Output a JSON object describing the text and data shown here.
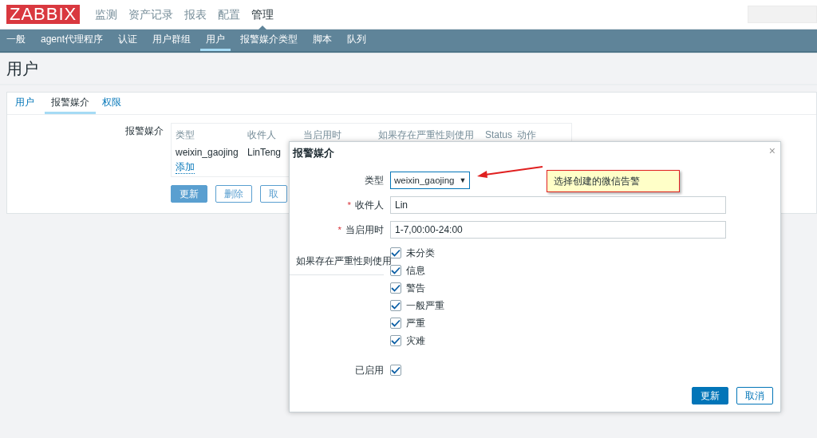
{
  "logo": "ZABBIX",
  "top_menu": [
    {
      "label": "监测",
      "selected": false
    },
    {
      "label": "资产记录",
      "selected": false
    },
    {
      "label": "报表",
      "selected": false
    },
    {
      "label": "配置",
      "selected": false
    },
    {
      "label": "管理",
      "selected": true
    }
  ],
  "sub_menu": [
    {
      "label": "一般",
      "selected": false
    },
    {
      "label": "agent代理程序",
      "selected": false
    },
    {
      "label": "认证",
      "selected": false
    },
    {
      "label": "用户群组",
      "selected": false
    },
    {
      "label": "用户",
      "selected": true
    },
    {
      "label": "报警媒介类型",
      "selected": false
    },
    {
      "label": "脚本",
      "selected": false
    },
    {
      "label": "队列",
      "selected": false
    }
  ],
  "page_title": "用户",
  "tabs": [
    {
      "label": "用户",
      "selected": false
    },
    {
      "label": "报警媒介",
      "selected": true
    },
    {
      "label": "权限",
      "selected": false
    }
  ],
  "media": {
    "label": "报警媒介",
    "columns": [
      "类型",
      "收件人",
      "当启用时",
      "如果存在严重性则使用",
      "Status",
      "动作"
    ],
    "rows": [
      [
        "weixin_gaojing",
        "LinTeng"
      ]
    ],
    "add_link": "添加",
    "buttons": [
      {
        "label": "更新",
        "primary": true
      },
      {
        "label": "删除",
        "primary": false
      },
      {
        "label": "取",
        "primary": false
      }
    ]
  },
  "dialog": {
    "title": "报警媒介",
    "close": "×",
    "fields": [
      {
        "kind": "select",
        "label": "类型",
        "value": "weixin_gaojing",
        "caret": "▼"
      },
      {
        "kind": "text",
        "label": "收件人",
        "value": "Lin",
        "marker": "*"
      },
      {
        "kind": "text",
        "label": "当启用时",
        "value": "1-7,00:00-24:00",
        "marker": "*"
      }
    ],
    "severities": {
      "label": "如果存在严重性则使用",
      "options": [
        {
          "label": "未分类",
          "checked": true
        },
        {
          "label": "信息",
          "checked": true
        },
        {
          "label": "警告",
          "checked": true
        },
        {
          "label": "一般严重",
          "checked": true
        },
        {
          "label": "严重",
          "checked": true
        },
        {
          "label": "灾难",
          "checked": true
        }
      ]
    },
    "enabled": {
      "label": "已启用",
      "checked": true
    },
    "buttons": [
      {
        "label": "更新",
        "primary": true
      },
      {
        "label": "取消",
        "primary": false
      }
    ]
  },
  "annotation": {
    "text": "选择创建的微信告警"
  }
}
